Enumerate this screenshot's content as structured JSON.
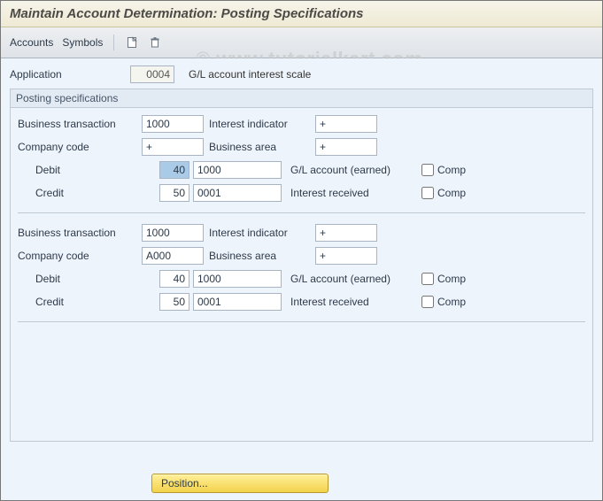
{
  "header": {
    "title": "Maintain Account Determination: Posting Specifications"
  },
  "toolbar": {
    "accounts_label": "Accounts",
    "symbols_label": "Symbols"
  },
  "app": {
    "label": "Application",
    "value": "0004",
    "desc": "G/L account interest scale"
  },
  "group": {
    "title": "Posting specifications",
    "labels": {
      "business_transaction": "Business transaction",
      "interest_indicator": "Interest indicator",
      "company_code": "Company code",
      "business_area": "Business area",
      "debit": "Debit",
      "credit": "Credit",
      "comp": "Comp"
    },
    "blocks": [
      {
        "business_transaction": "1000",
        "interest_indicator": "+",
        "company_code": "+",
        "business_area": "+",
        "debit": {
          "key": "40",
          "account": "1000",
          "desc": "G/L account (earned)",
          "comp": false,
          "key_highlight": true
        },
        "credit": {
          "key": "50",
          "account": "0001",
          "desc": "Interest received",
          "comp": false,
          "key_highlight": false
        }
      },
      {
        "business_transaction": "1000",
        "interest_indicator": "+",
        "company_code": "A000",
        "business_area": "+",
        "debit": {
          "key": "40",
          "account": "1000",
          "desc": "G/L account (earned)",
          "comp": false,
          "key_highlight": false
        },
        "credit": {
          "key": "50",
          "account": "0001",
          "desc": "Interest received",
          "comp": false,
          "key_highlight": false
        }
      }
    ]
  },
  "bottom": {
    "position_label": "Position..."
  },
  "watermark": {
    "prefix": "©",
    "a": "www",
    "b": "tutorialkart",
    "c": "com"
  }
}
